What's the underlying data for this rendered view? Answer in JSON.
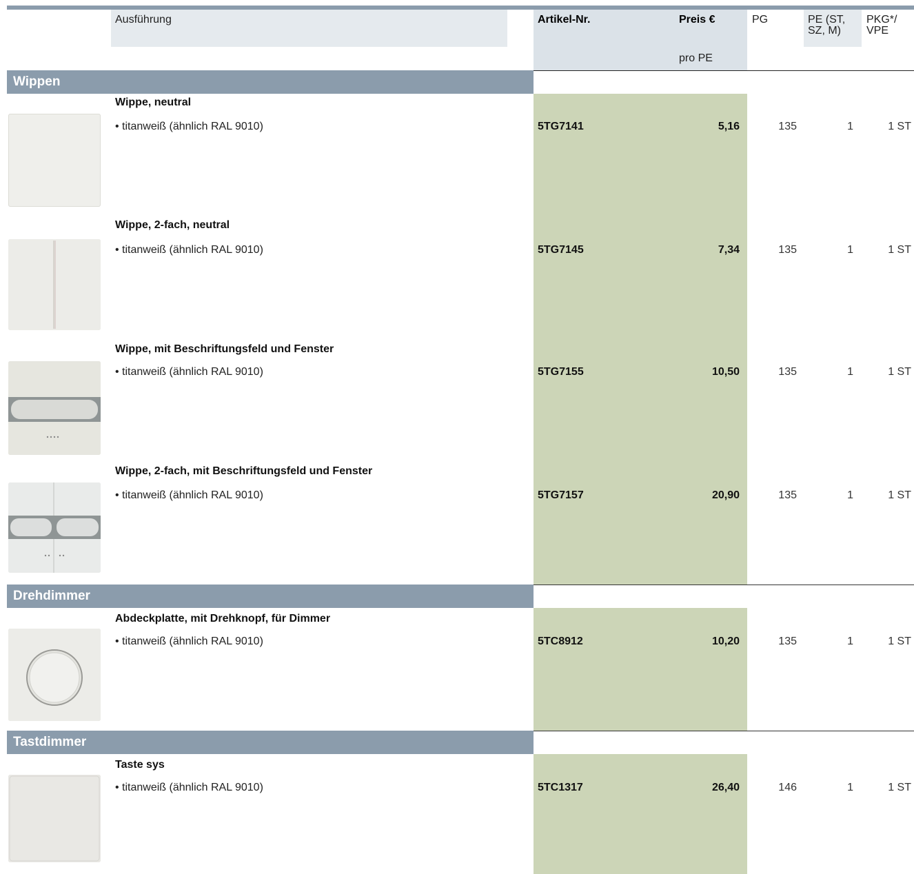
{
  "header": {
    "ausfuehrung": "Ausführung",
    "artikel_nr": "Artikel-Nr.",
    "preis": "Preis €",
    "pro_pe": "pro PE",
    "pg": "PG",
    "pe_line1": "PE (ST,",
    "pe_line2": "SZ, M)",
    "pkg_line1": "PKG*/",
    "pkg_line2": "VPE"
  },
  "sections": [
    {
      "title": "Wippen",
      "items": [
        {
          "title": "Wippe, neutral",
          "desc": "• titanweiß (ähnlich RAL 9010)",
          "artnr": "5TG7141",
          "price": "5,16",
          "pg": "135",
          "pe": "1",
          "pkg": "1 ST",
          "icon": "rocker-single-icon"
        },
        {
          "title": "Wippe, 2-fach, neutral",
          "desc": "• titanweiß (ähnlich RAL 9010)",
          "artnr": "5TG7145",
          "price": "7,34",
          "pg": "135",
          "pe": "1",
          "pkg": "1 ST",
          "icon": "rocker-double-icon"
        },
        {
          "title": "Wippe, mit Beschriftungsfeld und Fenster",
          "desc": "• titanweiß (ähnlich RAL 9010)",
          "artnr": "5TG7155",
          "price": "10,50",
          "pg": "135",
          "pe": "1",
          "pkg": "1 ST",
          "icon": "rocker-label-window-icon"
        },
        {
          "title": "Wippe, 2-fach, mit Beschriftungsfeld und Fenster",
          "desc": "• titanweiß (ähnlich RAL 9010)",
          "artnr": "5TG7157",
          "price": "20,90",
          "pg": "135",
          "pe": "1",
          "pkg": "1 ST",
          "icon": "rocker-double-label-window-icon"
        }
      ]
    },
    {
      "title": "Drehdimmer",
      "items": [
        {
          "title": "Abdeckplatte, mit Drehknopf, für Dimmer",
          "desc": "• titanweiß (ähnlich RAL 9010)",
          "artnr": "5TC8912",
          "price": "10,20",
          "pg": "135",
          "pe": "1",
          "pkg": "1 ST",
          "icon": "rotary-dimmer-icon"
        }
      ]
    },
    {
      "title": "Tastdimmer",
      "items": [
        {
          "title": "Taste sys",
          "desc": "• titanweiß (ähnlich RAL 9010)",
          "artnr": "5TC1317",
          "price": "26,40",
          "pg": "146",
          "pe": "1",
          "pkg": "1 ST",
          "icon": "push-button-icon"
        }
      ]
    }
  ],
  "colors": {
    "section_bar": "#8b9cac",
    "price_column_bg": "#ccd5b7",
    "header_bg": "#dbe2e8"
  }
}
